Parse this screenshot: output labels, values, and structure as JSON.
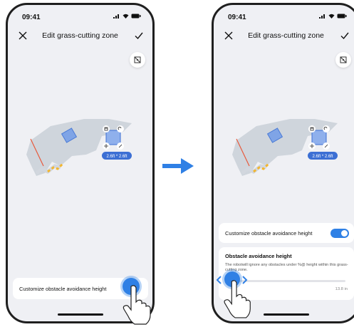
{
  "status": {
    "time": "09:41"
  },
  "nav": {
    "title": "Edit grass-cutting zone"
  },
  "map": {
    "dimension_label": "2.6ft * 2.6ft"
  },
  "left_card": {
    "label": "Customize obstacle avoidance height"
  },
  "right_card": {
    "toggle_label": "Customize obstacle avoidance height",
    "toggle_on": true
  },
  "height_card": {
    "title": "Obstacle avoidance height",
    "description": "The robotwill ignore any obstacles under %@ height within this grass-cutting zone.",
    "max_value": "13.8 in"
  },
  "colors": {
    "accent": "#2f80e5",
    "background": "#eff0f4"
  }
}
